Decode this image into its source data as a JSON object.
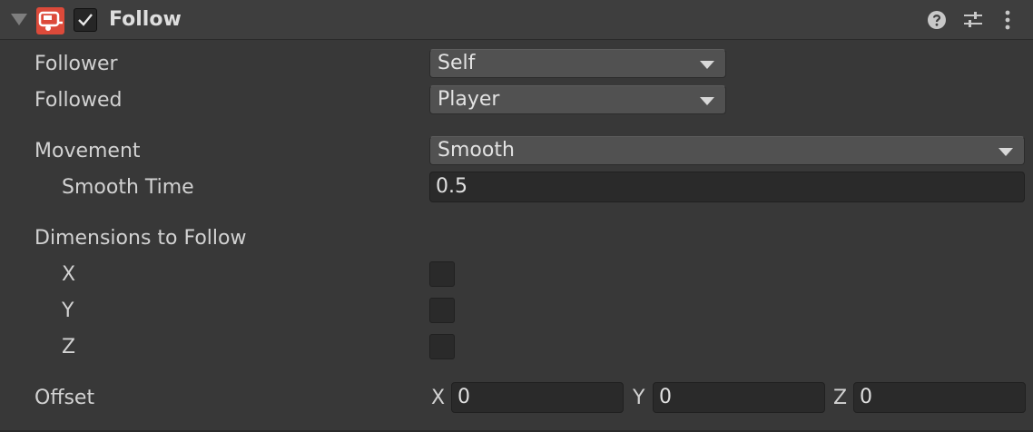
{
  "header": {
    "title": "Follow",
    "enabled": true,
    "icons": {
      "component": "vehicle-component-icon",
      "help": "help-icon",
      "presets": "presets-icon",
      "menu": "kebab-menu-icon"
    },
    "icon_color": "#dc4a3a"
  },
  "fields": {
    "follower": {
      "label": "Follower",
      "value": "Self"
    },
    "followed": {
      "label": "Followed",
      "value": "Player"
    },
    "movement": {
      "label": "Movement",
      "value": "Smooth"
    },
    "smooth_time": {
      "label": "Smooth Time",
      "value": "0.5"
    },
    "dimensions": {
      "label": "Dimensions to Follow",
      "x": {
        "label": "X",
        "checked": false
      },
      "y": {
        "label": "Y",
        "checked": false
      },
      "z": {
        "label": "Z",
        "checked": false
      }
    },
    "offset": {
      "label": "Offset",
      "x_label": "X",
      "x": "0",
      "y_label": "Y",
      "y": "0",
      "z_label": "Z",
      "z": "0"
    }
  }
}
